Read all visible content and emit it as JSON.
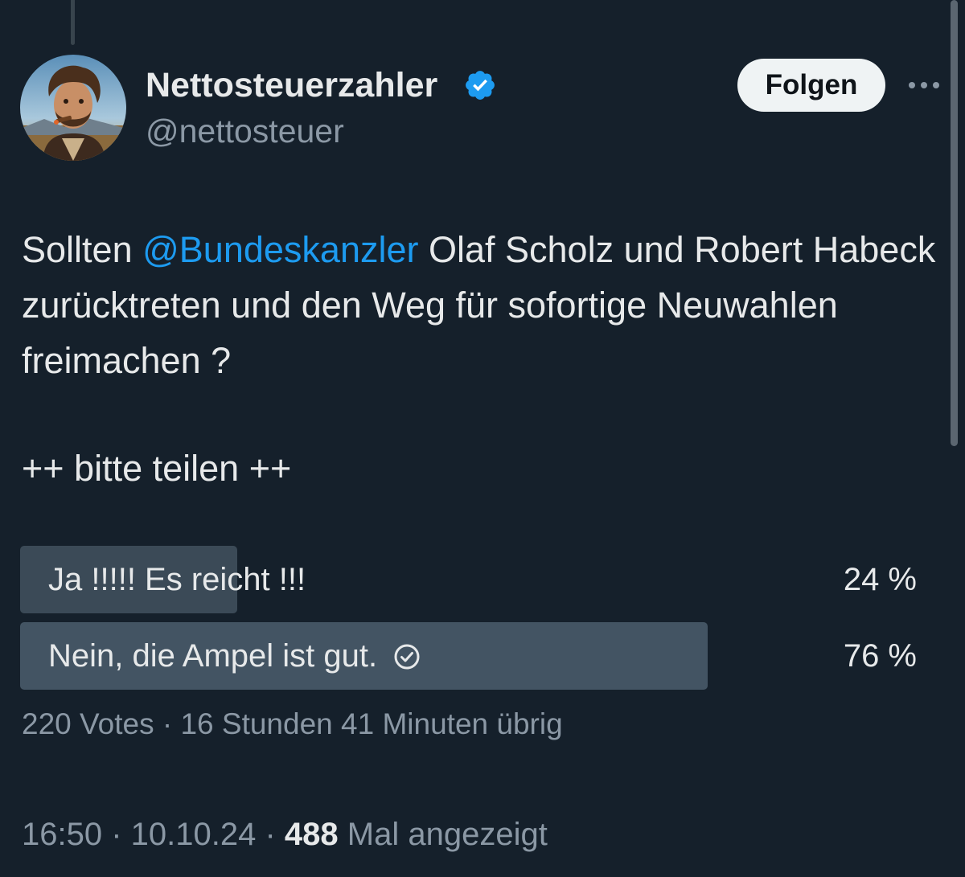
{
  "author": {
    "display_name": "Nettosteuerzahler",
    "handle": "@nettosteuer",
    "verified_icon": "verified-badge-icon",
    "avatar": "user-avatar"
  },
  "header": {
    "follow_label": "Folgen",
    "more_icon": "more-dots-icon"
  },
  "tweet": {
    "text_before": "Sollten ",
    "mention": "@Bundeskanzler",
    "text_after": " Olaf Scholz und Robert Habeck zurücktreten und den Weg für sofortige Neuwahlen freimachen ?",
    "cta": "++ bitte teilen ++"
  },
  "poll": {
    "options": [
      {
        "label": "Ja !!!!! Es reicht !!!",
        "percent_label": "24 %",
        "percent": 24,
        "selected": false
      },
      {
        "label": "Nein, die Ampel ist gut.",
        "percent_label": "76 %",
        "percent": 76,
        "selected": true
      }
    ],
    "meta": "220 Votes · 16 Stunden 41 Minuten übrig"
  },
  "footer": {
    "time": "16:50",
    "date": "10.10.24",
    "views": "488",
    "views_suffix": "Mal angezeigt"
  },
  "colors": {
    "background": "#15202b",
    "mention": "#1d9bf0",
    "verified": "#1d9bf0",
    "secondary_text": "#8b98a5"
  }
}
